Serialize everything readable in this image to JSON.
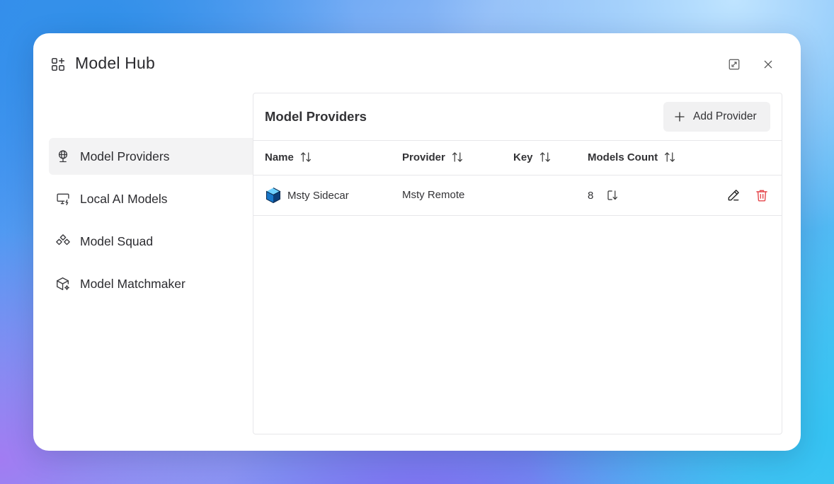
{
  "window": {
    "title": "Model Hub",
    "title_icon": "apps-add-icon",
    "expand_icon": "expand-icon",
    "close_icon": "close-icon"
  },
  "sidebar": {
    "items": [
      {
        "label": "Model Providers",
        "icon": "globe-stand-icon",
        "active": true
      },
      {
        "label": "Local AI Models",
        "icon": "monitor-bolt-icon",
        "active": false
      },
      {
        "label": "Model Squad",
        "icon": "diamonds-icon",
        "active": false
      },
      {
        "label": "Model Matchmaker",
        "icon": "cube-sparkle-icon",
        "active": false
      }
    ]
  },
  "panel": {
    "title": "Model Providers",
    "add_button": {
      "label": "Add Provider",
      "icon": "plus-icon"
    },
    "columns": [
      "Name",
      "Provider",
      "Key",
      "Models Count"
    ],
    "rows": [
      {
        "name": "Msty Sidecar",
        "provider": "Msty Remote",
        "key": "",
        "models_count": "8"
      }
    ]
  },
  "colors": {
    "delete": "#e5484d",
    "active_nav_bg": "#f3f3f4",
    "border": "#e7e7ea"
  }
}
